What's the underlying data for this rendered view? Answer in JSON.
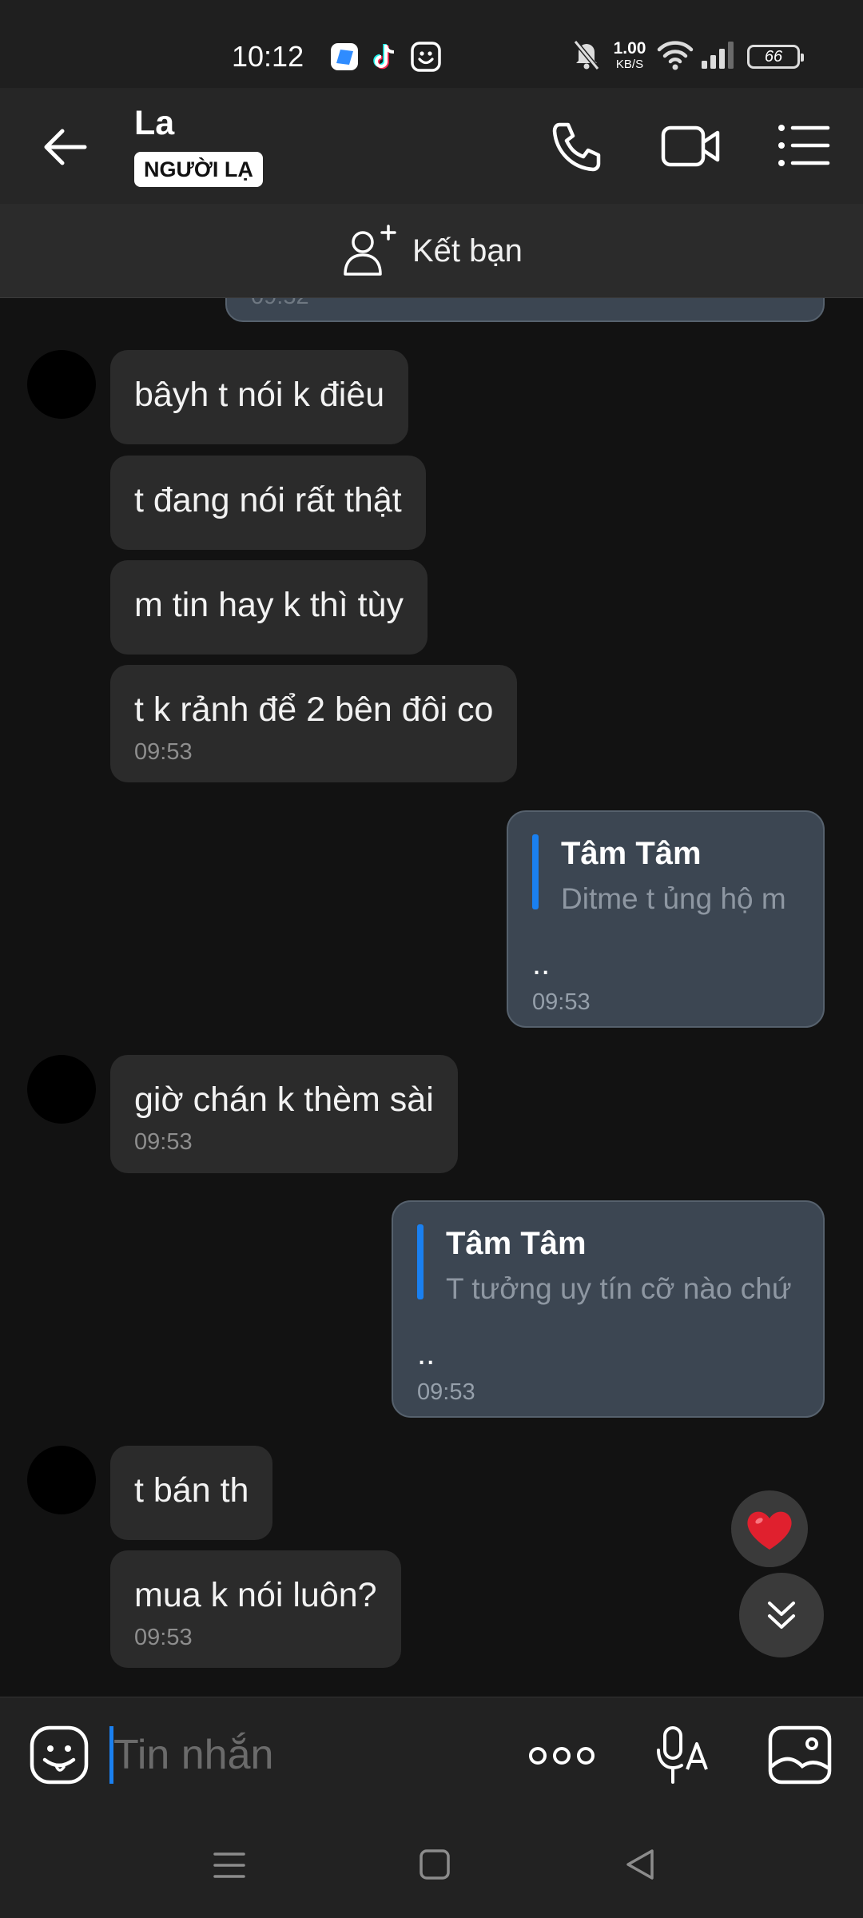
{
  "status_bar": {
    "time": "10:12",
    "net_speed_value": "1.00",
    "net_speed_unit": "KB/S",
    "battery": "66",
    "app_icons": [
      "files-app-icon",
      "tiktok-icon",
      "smiley-app-icon"
    ],
    "system_icons": [
      "mute-bell-icon",
      "wifi-icon",
      "signal-icon",
      "battery-icon"
    ]
  },
  "header": {
    "contact_name": "La",
    "badge": "NGƯỜI LẠ",
    "actions": [
      "back-arrow-icon",
      "phone-icon",
      "video-camera-icon",
      "menu-list-icon"
    ]
  },
  "friend_bar": {
    "label": "Kết bạn"
  },
  "chat": {
    "previous_timestamp": "09:52",
    "incoming_group_1": {
      "messages": [
        "bâyh t nói k điêu",
        "t đang nói rất thật",
        "m tin hay k thì tùy",
        "t k rảnh để 2 bên đôi co"
      ],
      "timestamp": "09:53"
    },
    "outgoing_1": {
      "quote_name": "Tâm Tâm",
      "quote_text": "Ditme t ủng hộ m",
      "text": "..",
      "timestamp": "09:53"
    },
    "incoming_group_2": {
      "messages": [
        "giờ chán k thèm sài"
      ],
      "timestamp": "09:53"
    },
    "outgoing_2": {
      "quote_name": "Tâm Tâm",
      "quote_text": "T tưởng uy tín cỡ nào chứ",
      "text": "..",
      "timestamp": "09:53"
    },
    "incoming_group_3": {
      "messages": [
        "t bán th",
        "mua k nói luôn?"
      ],
      "timestamp": "09:53"
    },
    "colors": {
      "background": "#121212",
      "incoming_bubble": "#2b2b2b",
      "outgoing_bubble": "#3c4652",
      "quote_accent": "#1a80f0",
      "heart": "#e0202e"
    }
  },
  "composer": {
    "placeholder": "Tin nhắn",
    "icons": [
      "sticker-icon",
      "more-dots-icon",
      "voice-to-text-icon",
      "image-icon"
    ]
  },
  "nav_bar": {
    "icons": [
      "recent-apps-icon",
      "home-icon",
      "back-triangle-icon"
    ]
  }
}
